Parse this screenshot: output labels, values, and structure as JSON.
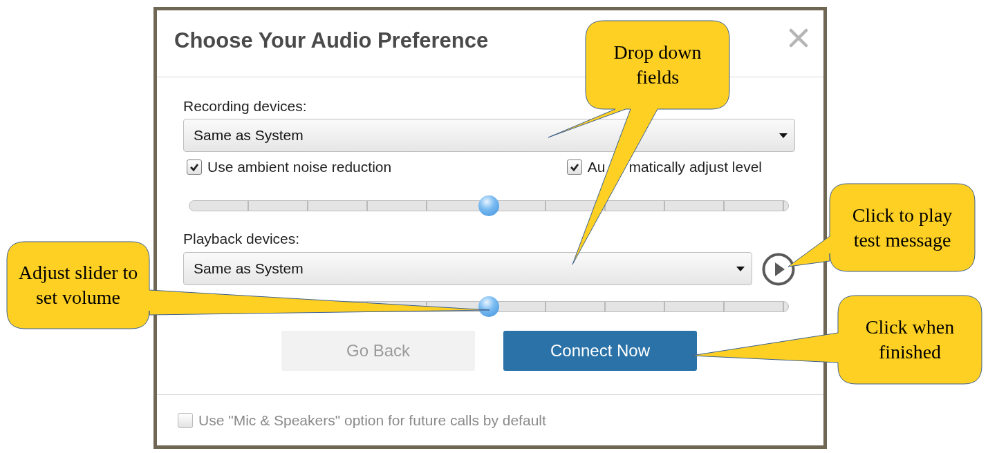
{
  "dialog": {
    "title": "Choose Your Audio Preference",
    "recording": {
      "label": "Recording devices:",
      "value": "Same as System"
    },
    "options": [
      {
        "label": "Use ambient noise reduction",
        "checked": true
      },
      {
        "label": "Au",
        "label_continued": "matically adjust level",
        "checked": true
      }
    ],
    "recording_slider": {
      "level": 0.5
    },
    "playback": {
      "label": "Playback devices:",
      "value": "Same as System"
    },
    "playback_slider": {
      "level": 0.5
    },
    "buttons": [
      {
        "label": "Go Back",
        "disabled": true
      },
      {
        "label": "Connect Now",
        "disabled": false
      }
    ],
    "default_option": {
      "label": "Use \"Mic & Speakers\" option for future calls by default",
      "checked": false
    }
  },
  "callouts": [
    {
      "text": "Drop down fields"
    },
    {
      "text": "Click to play test message"
    },
    {
      "text": "Adjust slider to set volume"
    },
    {
      "text": "Click when finished"
    }
  ]
}
